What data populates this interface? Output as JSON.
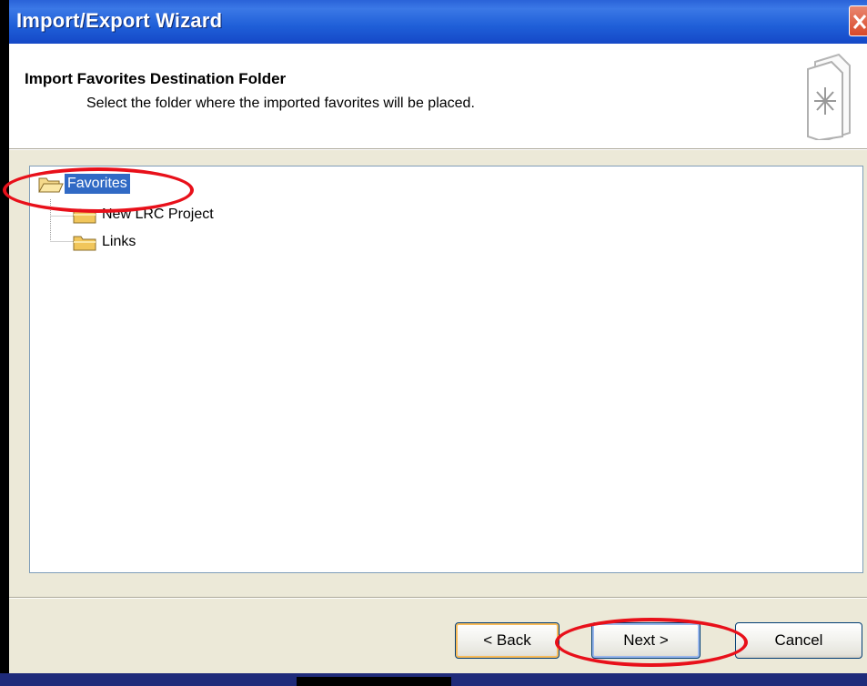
{
  "window": {
    "title": "Import/Export Wizard"
  },
  "header": {
    "title": "Import Favorites Destination Folder",
    "subtitle": "Select the folder where the imported favorites will be placed.",
    "icon": "favorites-doc-icon"
  },
  "tree": {
    "root": {
      "label": "Favorites",
      "selected": true,
      "icon": "folder-open-icon"
    },
    "children": [
      {
        "label": "New LRC Project",
        "icon": "folder-icon"
      },
      {
        "label": "Links",
        "icon": "folder-icon"
      }
    ]
  },
  "buttons": {
    "back": "< Back",
    "next": "Next >",
    "cancel": "Cancel"
  },
  "colors": {
    "titlebar": "#1f5fd8",
    "dialog_bg": "#ece9d8",
    "selection": "#316ac5",
    "annotation": "#e8101a"
  }
}
